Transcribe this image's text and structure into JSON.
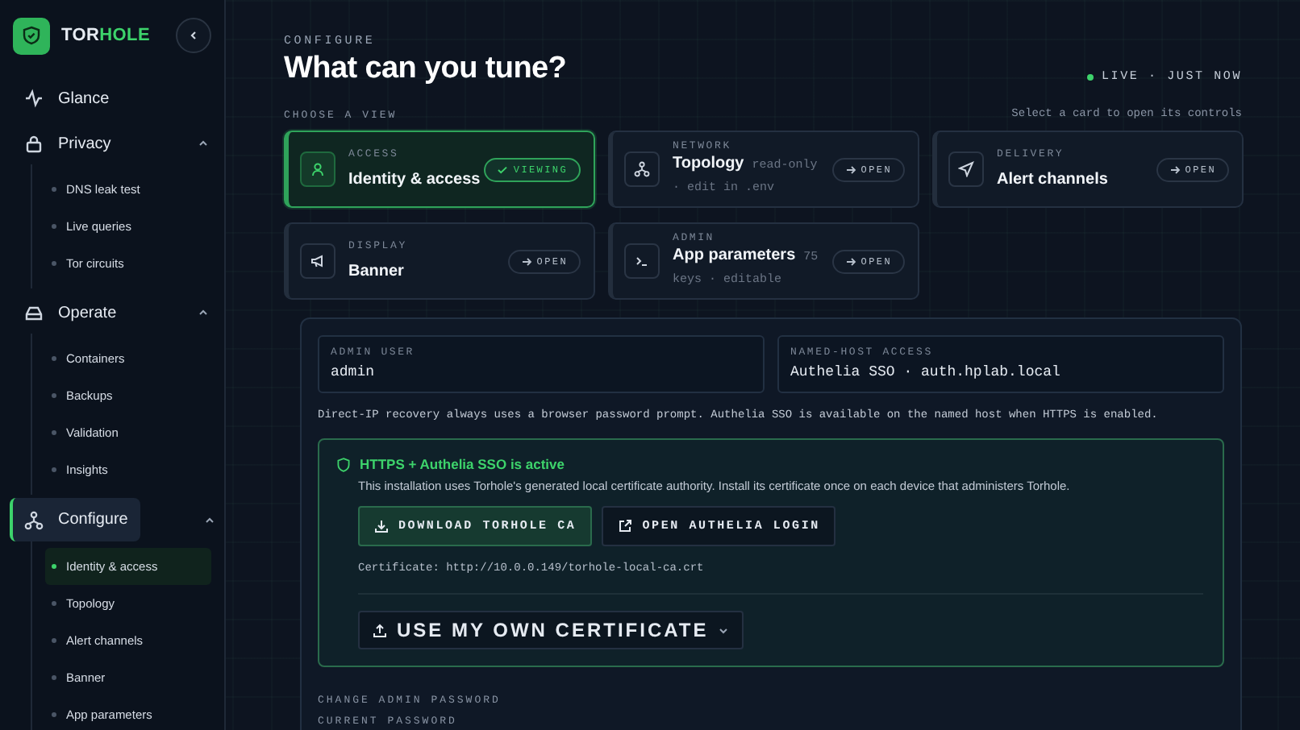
{
  "sidebar": {
    "brand_first": "TOR",
    "brand_second": "HOLE",
    "items": [
      {
        "label": "Glance",
        "kind": "link",
        "selected": false
      },
      {
        "label": "Privacy",
        "kind": "group",
        "selected": false,
        "expanded": true,
        "children": [
          {
            "label": "DNS leak test",
            "selected": false
          },
          {
            "label": "Live queries",
            "selected": false
          },
          {
            "label": "Tor circuits",
            "selected": false
          }
        ]
      },
      {
        "label": "Operate",
        "kind": "group",
        "selected": false,
        "expanded": true,
        "children": [
          {
            "label": "Containers",
            "selected": false
          },
          {
            "label": "Backups",
            "selected": false
          },
          {
            "label": "Validation",
            "selected": false
          },
          {
            "label": "Insights",
            "selected": false
          }
        ]
      },
      {
        "label": "Configure",
        "kind": "group",
        "selected": true,
        "expanded": true,
        "children": [
          {
            "label": "Identity & access",
            "selected": true
          },
          {
            "label": "Topology",
            "selected": false
          },
          {
            "label": "Alert channels",
            "selected": false
          },
          {
            "label": "Banner",
            "selected": false
          },
          {
            "label": "App parameters",
            "selected": false
          }
        ]
      }
    ]
  },
  "header": {
    "eyebrow": "CONFIGURE",
    "title": "What can you tune?",
    "status": {
      "text": "LIVE · JUST NOW",
      "live": true
    }
  },
  "view_picker": {
    "label": "CHOOSE A VIEW",
    "hint": "Select a card to open its controls",
    "cards": [
      {
        "category": "ACCESS",
        "title": "Identity & access",
        "action": "VIEWING",
        "selected": true
      },
      {
        "category": "NETWORK",
        "title": "Topology",
        "note": "read-only · edit in .env",
        "action": "OPEN",
        "selected": false
      },
      {
        "category": "DELIVERY",
        "title": "Alert channels",
        "action": "OPEN",
        "selected": false
      },
      {
        "category": "DISPLAY",
        "title": "Banner",
        "action": "OPEN",
        "selected": false
      },
      {
        "category": "ADMIN",
        "title": "App parameters",
        "note": "75 keys · editable",
        "action": "OPEN",
        "selected": false
      }
    ]
  },
  "identity_panel": {
    "fields": [
      {
        "label": "ADMIN USER",
        "value": "admin"
      },
      {
        "label": "NAMED-HOST ACCESS",
        "value": "Authelia SSO · auth.hplab.local"
      }
    ],
    "note": "Direct-IP recovery always uses a browser password prompt. Authelia SSO is available on the named host when HTTPS is enabled.",
    "sso": {
      "title": "HTTPS + Authelia SSO is active",
      "description": "This installation uses Torhole's generated local certificate authority. Install its certificate once on each device that administers Torhole.",
      "buttons": [
        {
          "label": "DOWNLOAD TORHOLE CA",
          "kind": "primary"
        },
        {
          "label": "OPEN AUTHELIA LOGIN",
          "kind": "secondary"
        }
      ],
      "certificate": "Certificate: http://10.0.0.149/torhole-local-ca.crt",
      "own_cert_button": "USE MY OWN CERTIFICATE"
    },
    "password_section": {
      "title": "CHANGE ADMIN PASSWORD",
      "field_label": "CURRENT PASSWORD"
    }
  }
}
